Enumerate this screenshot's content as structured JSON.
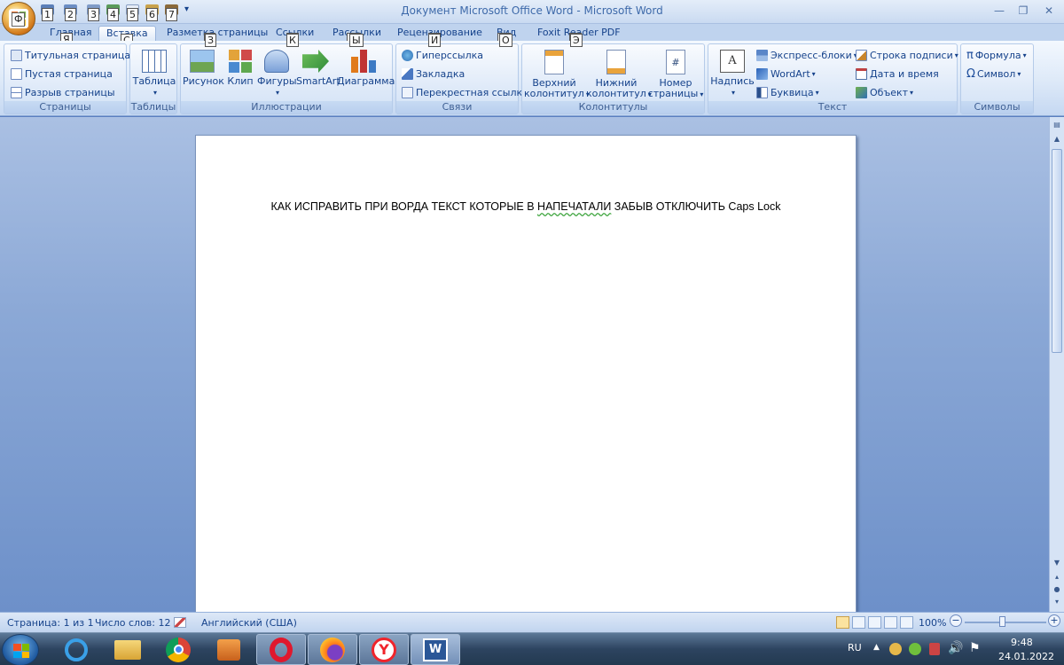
{
  "window": {
    "title": "Документ Microsoft Office Word - Microsoft Word",
    "office_key": "Ф",
    "quick_access_keys": [
      "1",
      "2",
      "3",
      "4",
      "5",
      "6",
      "7"
    ],
    "minimize_glyph": "—",
    "maximize_glyph": "❐",
    "close_glyph": "✕"
  },
  "tabs": [
    {
      "label": "Главная",
      "key": "Я"
    },
    {
      "label": "Вставка",
      "key": "С",
      "active": true
    },
    {
      "label": "Разметка страницы",
      "key": "З"
    },
    {
      "label": "Ссылки",
      "key": "К"
    },
    {
      "label": "Рассылки",
      "key": "Ы"
    },
    {
      "label": "Рецензирование",
      "key": "И"
    },
    {
      "label": "Вид",
      "key": "О"
    },
    {
      "label": "Foxit Reader PDF",
      "key": "Э"
    }
  ],
  "ribbon": {
    "pages": {
      "label": "Страницы",
      "items": [
        "Титульная страница",
        "Пустая страница",
        "Разрыв страницы"
      ]
    },
    "tables": {
      "label": "Таблицы",
      "items": [
        "Таблица"
      ]
    },
    "illustrations": {
      "label": "Иллюстрации",
      "items": [
        "Рисунок",
        "Клип",
        "Фигуры",
        "SmartArt",
        "Диаграмма"
      ]
    },
    "links": {
      "label": "Связи",
      "items": [
        "Гиперссылка",
        "Закладка",
        "Перекрестная ссылка"
      ]
    },
    "headers": {
      "label": "Колонтитулы",
      "top": [
        "Верхний",
        "Нижний",
        "Номер"
      ],
      "bottom": [
        "колонтитул",
        "колонтитул",
        "страницы"
      ]
    },
    "text": {
      "label": "Текст",
      "textbox": "Надпись",
      "items": [
        "Экспресс-блоки",
        "WordArt",
        "Буквица",
        "Строка подписи",
        "Дата и время",
        "Объект"
      ]
    },
    "symbols": {
      "label": "Символы",
      "items": [
        "Формула",
        "Символ"
      ]
    }
  },
  "document": {
    "text_before": "КАК ИСПРАВИТЬ ПРИ ВОРДА ТЕКСТ КОТОРЫЕ В ",
    "text_misspelled": "НАПЕЧАТАЛИ",
    "text_after": " ЗАБЫВ ОТКЛЮЧИТЬ Caps Lock"
  },
  "status": {
    "page": "Страница: 1 из 1",
    "words": "Число слов: 12",
    "language": "Английский (США)",
    "zoom": "100%",
    "zoom_minus": "−",
    "zoom_plus": "+"
  },
  "taskbar": {
    "lang": "RU",
    "time": "9:48",
    "date": "24.01.2022"
  },
  "colors": {
    "ribbon_text": "#15428b",
    "opera": "#e0182d",
    "yandex": "#f0242b",
    "word": "#2b5797"
  }
}
